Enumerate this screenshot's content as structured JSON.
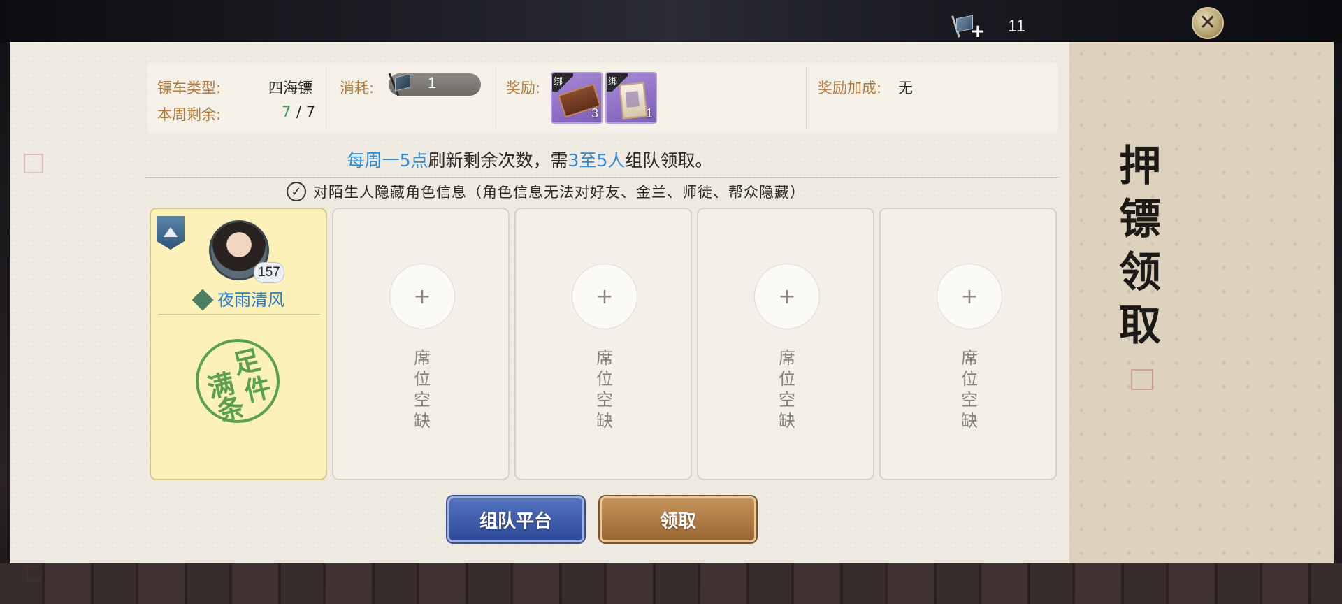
{
  "topbar": {
    "currency_value": "11",
    "currency_icon": "escort-flag-icon",
    "close_icon": "close-icon"
  },
  "info": {
    "cart_type_label": "镖车类型:",
    "cart_type_value": "四海镖",
    "weekly_remaining_label": "本周剩余:",
    "weekly_remaining_current": "7",
    "weekly_remaining_total": "/ 7",
    "cost_label": "消耗:",
    "cost_value": "1",
    "reward_label": "奖励:",
    "rewards": [
      {
        "bind_tag": "绑",
        "qty": "3",
        "icon": "wooden-box-icon"
      },
      {
        "bind_tag": "绑",
        "qty": "1",
        "icon": "card-icon"
      }
    ],
    "bonus_label": "奖励加成:",
    "bonus_value": "无"
  },
  "notice": {
    "part1": "每周一5点",
    "part2": "刷新剩余次数，需",
    "part3": "3至5人",
    "part4": "组队领取。"
  },
  "privacy": {
    "checked": true,
    "text": "对陌生人隐藏角色信息（角色信息无法对好友、金兰、师徒、帮众隐藏）"
  },
  "party": {
    "leader": {
      "level": "157",
      "name": "夜雨清风",
      "stamp_chars": [
        "满",
        "足",
        "条",
        "件"
      ]
    },
    "empty_slot_text": [
      "席",
      "位",
      "空",
      "缺"
    ],
    "add_symbol": "+"
  },
  "buttons": {
    "team_platform": "组队平台",
    "claim": "领取"
  },
  "title": [
    "押",
    "镖",
    "领",
    "取"
  ],
  "colors": {
    "accent_blue": "#2e8bd8",
    "label_brown": "#b07a3a",
    "remaining_green": "#3f9a5b",
    "stamp_green": "#5aa14c"
  }
}
